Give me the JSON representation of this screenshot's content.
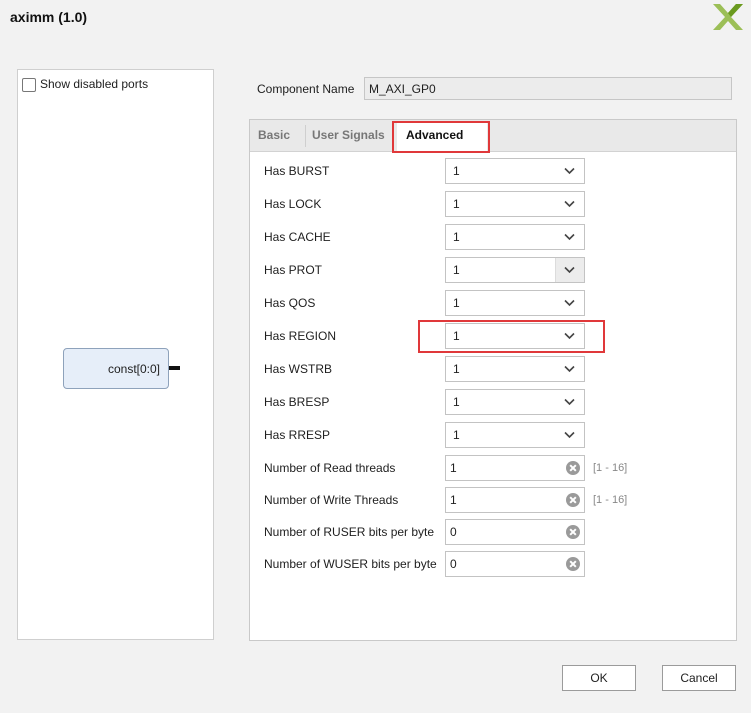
{
  "window": {
    "title": "aximm (1.0)"
  },
  "preview": {
    "show_disabled_label": "Show disabled ports",
    "show_disabled_checked": false,
    "block_port_label": "const[0:0]"
  },
  "component_name": {
    "label": "Component Name",
    "value": "M_AXI_GP0"
  },
  "tabs": [
    {
      "label": "Basic",
      "active": false
    },
    {
      "label": "User Signals",
      "active": false
    },
    {
      "label": "Advanced",
      "active": true
    }
  ],
  "params": {
    "has_burst": {
      "label": "Has BURST",
      "value": "1"
    },
    "has_lock": {
      "label": "Has LOCK",
      "value": "1"
    },
    "has_cache": {
      "label": "Has CACHE",
      "value": "1"
    },
    "has_prot": {
      "label": "Has PROT",
      "value": "1"
    },
    "has_qos": {
      "label": "Has QOS",
      "value": "1"
    },
    "has_region": {
      "label": "Has REGION",
      "value": "1"
    },
    "has_wstrb": {
      "label": "Has WSTRB",
      "value": "1"
    },
    "has_bresp": {
      "label": "Has BRESP",
      "value": "1"
    },
    "has_rresp": {
      "label": "Has RRESP",
      "value": "1"
    },
    "read_threads": {
      "label": "Number of Read threads",
      "value": "1",
      "range": "[1 - 16]"
    },
    "write_threads": {
      "label": "Number of Write Threads",
      "value": "1",
      "range": "[1 - 16]"
    },
    "ruser_bits": {
      "label": "Number of RUSER bits per byte",
      "value": "0"
    },
    "wuser_bits": {
      "label": "Number of WUSER bits per byte",
      "value": "0"
    }
  },
  "buttons": {
    "ok": "OK",
    "cancel": "Cancel"
  },
  "colors": {
    "highlight": "#e0383a",
    "logo": "#8db63c"
  },
  "icons": {
    "logo": "xilinx-logo-icon",
    "dropdown": "chevron-down-icon",
    "clear": "clear-icon"
  }
}
